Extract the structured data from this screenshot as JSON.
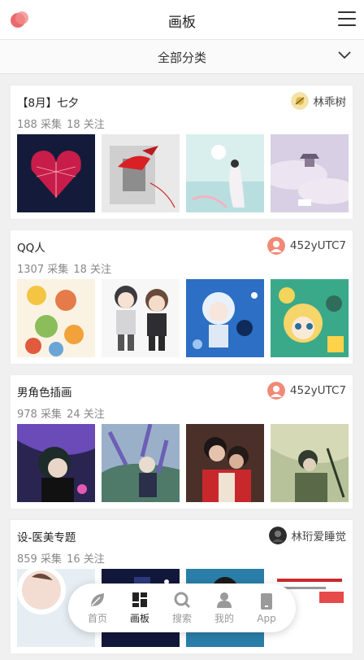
{
  "header": {
    "title": "画板"
  },
  "category": {
    "label": "全部分类"
  },
  "boards": [
    {
      "title": "【8月】七夕",
      "user": "林乖树",
      "pins": "188 采集",
      "follows": "18 关注"
    },
    {
      "title": "QQ人",
      "user": "452yUTC7",
      "pins": "1307 采集",
      "follows": "18 关注"
    },
    {
      "title": "男角色插画",
      "user": "452yUTC7",
      "pins": "978 采集",
      "follows": "24 关注"
    },
    {
      "title": "设-医美专题",
      "user": "林珩爱睡觉",
      "pins": "859 采集",
      "follows": "16 关注"
    }
  ],
  "nav": {
    "items": [
      {
        "label": "首页",
        "icon": "leaf-icon"
      },
      {
        "label": "画板",
        "icon": "board-grid-icon"
      },
      {
        "label": "搜索",
        "icon": "search-icon"
      },
      {
        "label": "我的",
        "icon": "user-icon"
      },
      {
        "label": "App",
        "icon": "phone-icon"
      }
    ]
  },
  "colors": {
    "accent": "#e94f52",
    "background": "#f0f0f0",
    "text": "#222222",
    "muted": "#888888"
  }
}
